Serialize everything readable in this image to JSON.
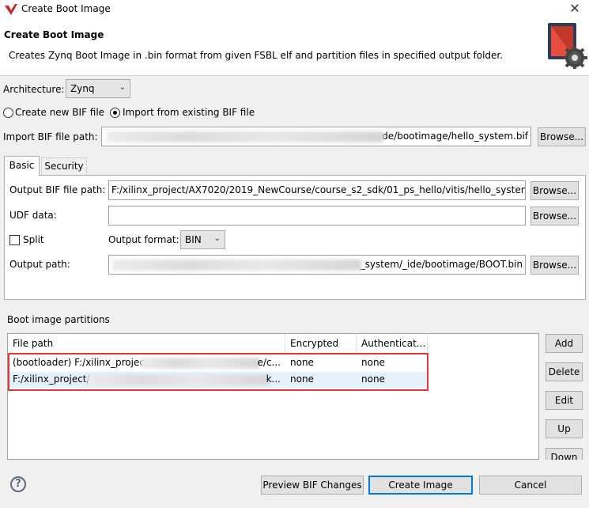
{
  "window": {
    "title": "Create Boot Image",
    "close_glyph": "✕"
  },
  "header": {
    "title": "Create Boot Image",
    "description": "Creates Zynq Boot Image in .bin format from given FSBL elf and partition files in specified output folder."
  },
  "architecture": {
    "label": "Architecture:",
    "value": "Zynq"
  },
  "bif_mode": {
    "create_label": "Create new BIF file",
    "import_label": "Import from existing BIF file",
    "selected": "import"
  },
  "import_bif": {
    "label": "Import BIF file path:",
    "value": "de/bootimage/hello_system.bif",
    "browse_label": "Browse..."
  },
  "tabs": [
    {
      "label": "Basic",
      "active": true
    },
    {
      "label": "Security",
      "active": false
    }
  ],
  "basic": {
    "output_bif": {
      "label": "Output BIF file path:",
      "value": "F:/xilinx_project/AX7020/2019_NewCourse/course_s2_sdk/01_ps_hello/vitis/hello_system/_ic",
      "browse_label": "Browse..."
    },
    "udf": {
      "label": "UDF data:",
      "value": "",
      "browse_label": "Browse..."
    },
    "split": {
      "label": "Split",
      "checked": false
    },
    "output_format": {
      "label": "Output format:",
      "value": "BIN"
    },
    "output_path": {
      "label": "Output path:",
      "value": "_system/_ide/bootimage/BOOT.bin",
      "browse_label": "Browse..."
    }
  },
  "partitions": {
    "section_label": "Boot image partitions",
    "columns": [
      "File path",
      "Encrypted",
      "Authenticat..."
    ],
    "rows": [
      {
        "path_start": "(bootloader) F:/xilinx_projec",
        "path_end": "e/c...",
        "encrypted": "none",
        "authenticated": "none"
      },
      {
        "path_start": "F:/xilinx_project/",
        "path_end": "k...",
        "encrypted": "none",
        "authenticated": "none"
      }
    ],
    "buttons": {
      "add": "Add",
      "delete": "Delete",
      "edit": "Edit",
      "up": "Up",
      "down": "Down"
    }
  },
  "footer": {
    "help_glyph": "?",
    "preview_label": "Preview BIF Changes",
    "create_label": "Create Image",
    "cancel_label": "Cancel"
  },
  "colors": {
    "highlight": "#e53935",
    "selected_row": "#e5f1fb",
    "primary_border": "#0078d7"
  },
  "icons": {
    "app": "xilinx-logo-icon",
    "header": "boot-image-gear-icon",
    "help": "help-icon"
  }
}
